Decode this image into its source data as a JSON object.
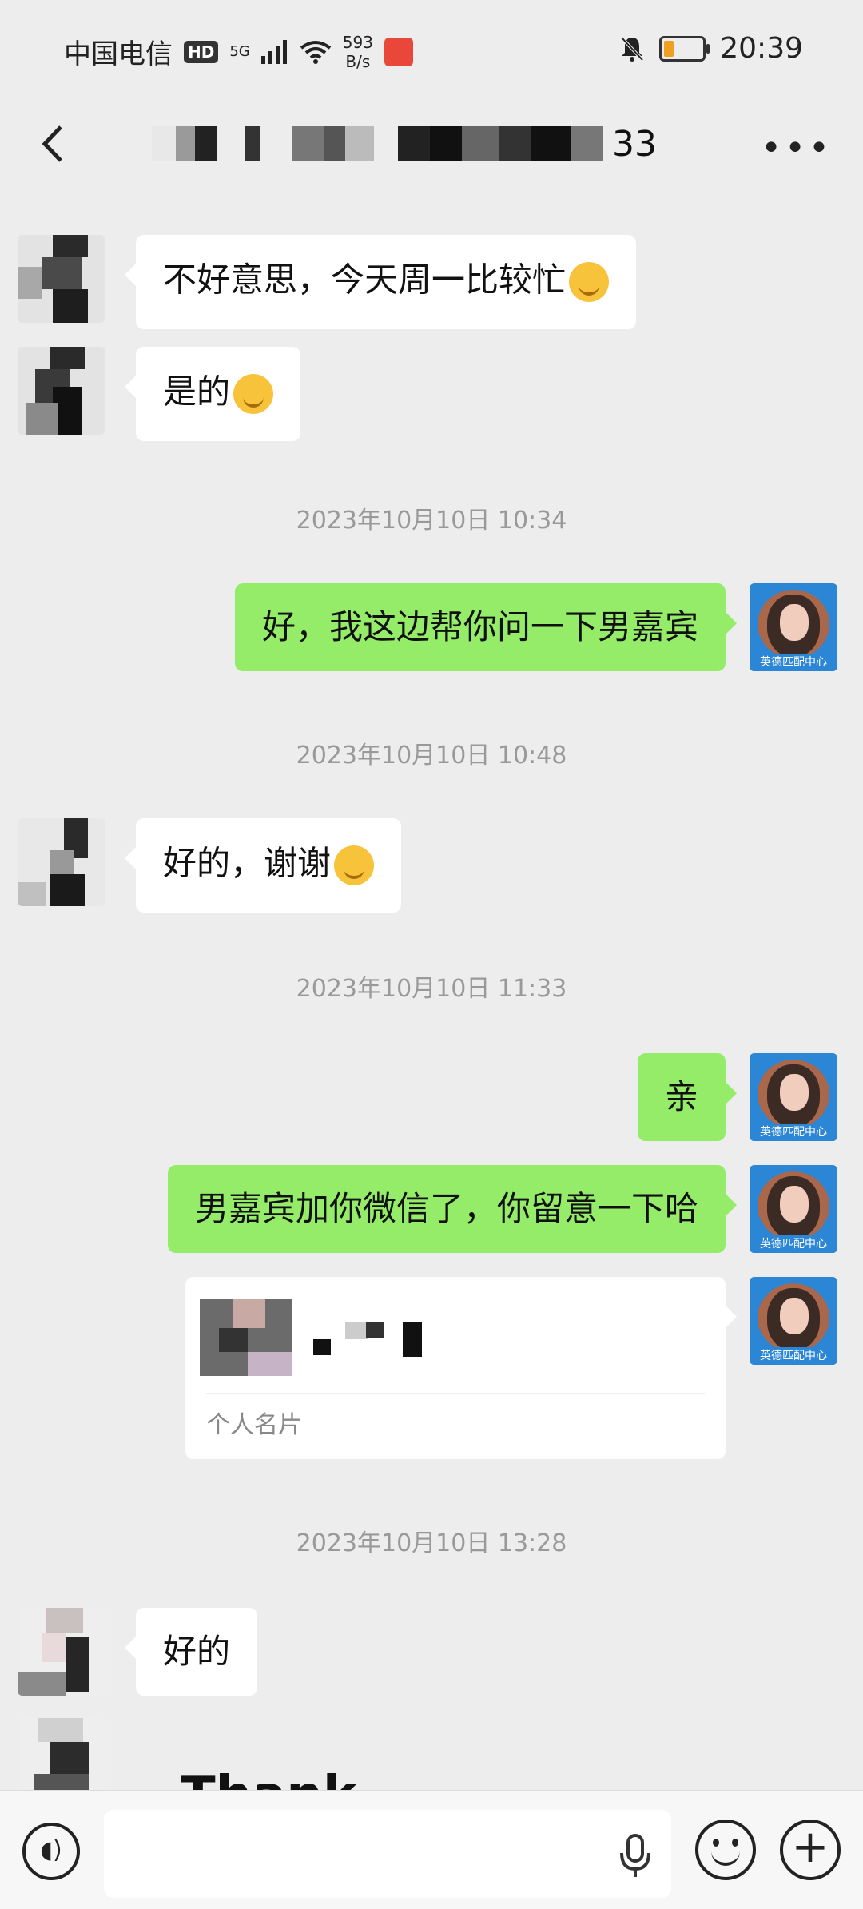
{
  "status_bar": {
    "carrier": "中国电信",
    "hd_badge": "HD",
    "network": "5G",
    "speed_value": "593",
    "speed_unit": "B/s",
    "time": "20:39"
  },
  "title_bar": {
    "contact_name_visible_suffix": "33"
  },
  "messages": {
    "m1": {
      "side": "in",
      "text": "不好意思，今天周一比较忙"
    },
    "m2": {
      "side": "in",
      "text": "是的"
    },
    "t1": "2023年10月10日 10:34",
    "m3": {
      "side": "out",
      "text": "好，我这边帮你问一下男嘉宾"
    },
    "t2": "2023年10月10日 10:48",
    "m4": {
      "side": "in",
      "text": "好的，谢谢"
    },
    "t3": "2023年10月10日 11:33",
    "m5": {
      "side": "out",
      "text": "亲"
    },
    "m6": {
      "side": "out",
      "text": "男嘉宾加你微信了，你留意一下哈"
    },
    "m7": {
      "side": "out",
      "type": "contact_card",
      "label": "个人名片"
    },
    "t4": "2023年10月10日 13:28",
    "m8": {
      "side": "in",
      "text": "好的"
    },
    "m9": {
      "side": "in",
      "type": "sticker",
      "text": "Thank"
    }
  },
  "my_avatar_caption": "英德匹配中心",
  "colors": {
    "background": "#ededed",
    "outgoing_bubble": "#95ec69",
    "incoming_bubble": "#ffffff",
    "timestamp": "#999999"
  },
  "icons": [
    "back-icon",
    "more-icon",
    "voice-icon",
    "mic-icon",
    "emoji-icon",
    "plus-icon"
  ]
}
